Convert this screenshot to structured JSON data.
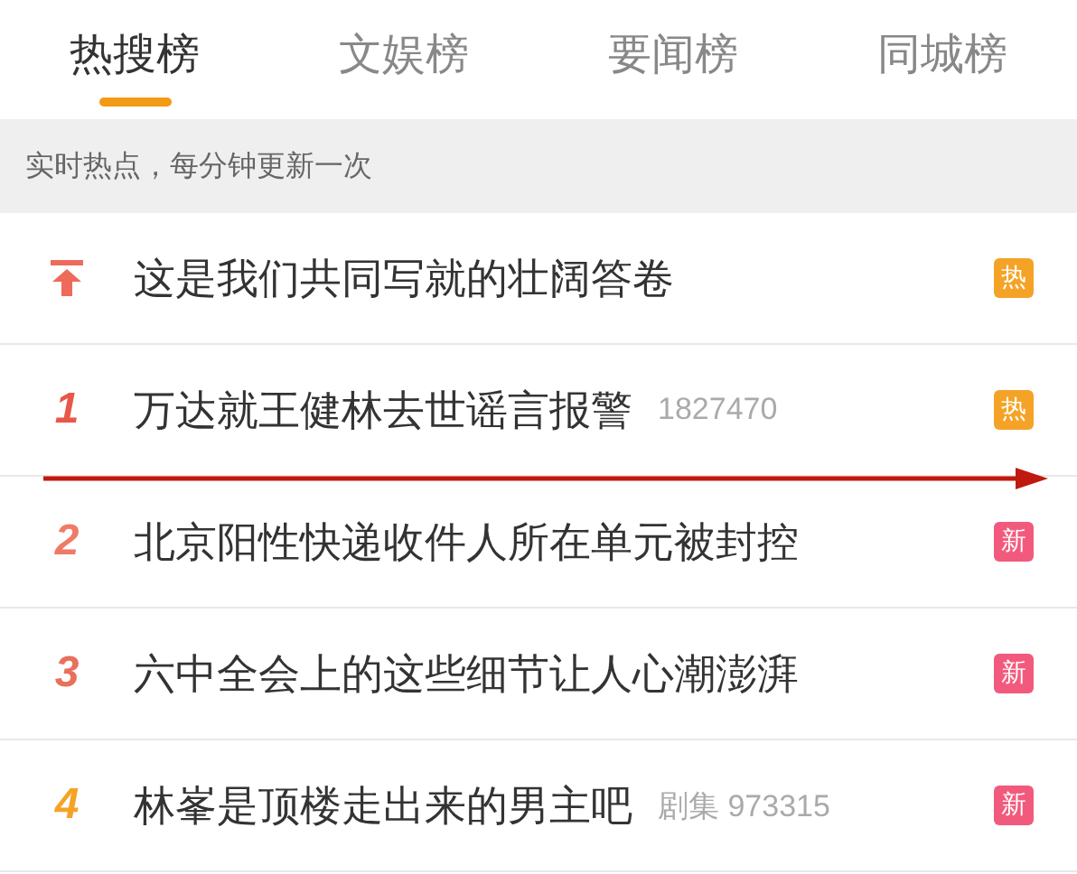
{
  "tabs": [
    {
      "label": "热搜榜",
      "selected": true
    },
    {
      "label": "文娱榜",
      "selected": false
    },
    {
      "label": "要闻榜",
      "selected": false
    },
    {
      "label": "同城榜",
      "selected": false
    }
  ],
  "notice": "实时热点，每分钟更新一次",
  "items": [
    {
      "kind": "pinned",
      "title": "这是我们共同写就的壮阔答卷",
      "badge": {
        "text": "热",
        "color": "#f5a327"
      },
      "color": "#ee6a5a"
    },
    {
      "kind": "ranked",
      "rank": "1",
      "title": "万达就王健林去世谣言报警",
      "meta": "1827470",
      "badge": {
        "text": "热",
        "color": "#f5a327"
      },
      "color": "#e9574a"
    },
    {
      "kind": "ranked",
      "rank": "2",
      "title": "北京阳性快递收件人所在单元被封控",
      "badge": {
        "text": "新",
        "color": "#f25a7d"
      },
      "color": "#f07a68"
    },
    {
      "kind": "ranked",
      "rank": "3",
      "title": "六中全会上的这些细节让人心潮澎湃",
      "badge": {
        "text": "新",
        "color": "#f25a7d"
      },
      "color": "#e8705c"
    },
    {
      "kind": "ranked",
      "rank": "4",
      "title": "林峯是顶楼走出来的男主吧",
      "meta": "剧集 973315",
      "badge": {
        "text": "新",
        "color": "#f25a7d"
      },
      "color": "#f5a327"
    }
  ]
}
